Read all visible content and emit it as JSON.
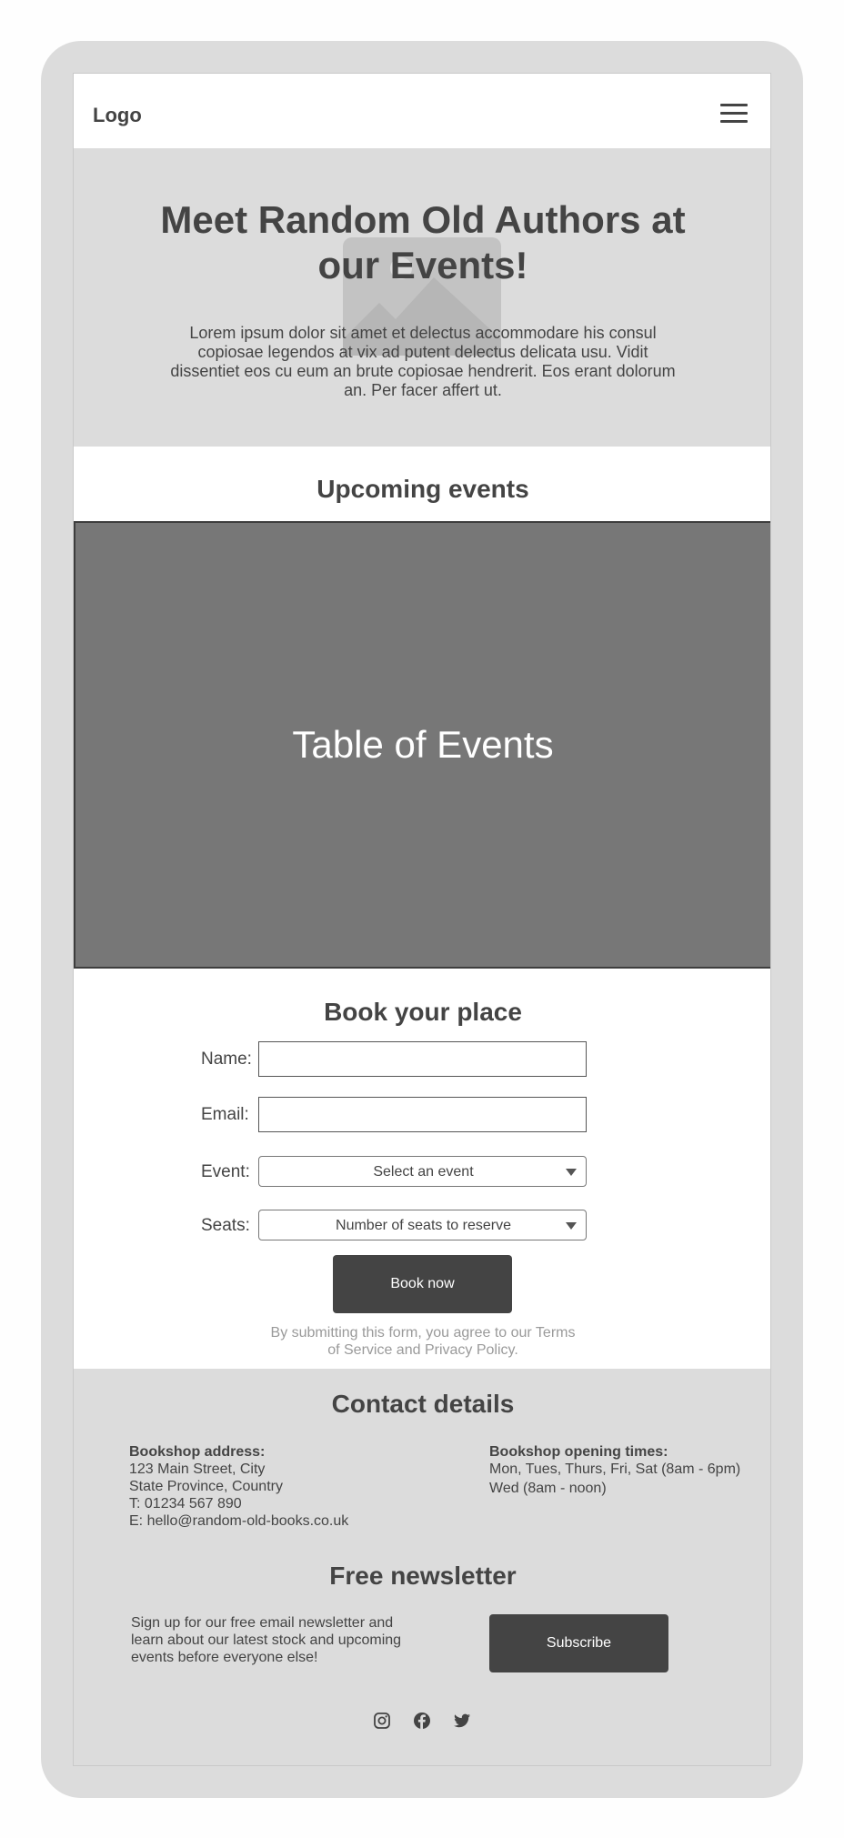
{
  "header": {
    "logo": "Logo",
    "menu_icon": "hamburger-menu-icon"
  },
  "hero": {
    "title": "Meet Random Old Authors at our Events!",
    "text": "Lorem ipsum dolor sit amet et delectus accommodare his consul copiosae legendos at vix ad putent delectus delicata usu. Vidit dissentiet eos cu eum an brute copiosae hendrerit. Eos erant dolorum an. Per facer affert ut.",
    "image_icon": "image-placeholder-icon"
  },
  "events": {
    "title": "Upcoming events",
    "table_label": "Table of Events"
  },
  "booking": {
    "title": "Book your place",
    "name_label": "Name:",
    "name_value": "",
    "email_label": "Email:",
    "email_value": "",
    "event_label": "Event:",
    "event_selected": "Select an event",
    "seats_label": "Seats:",
    "seats_selected": "Number of seats to reserve",
    "submit_label": "Book now",
    "disclaimer": "By submitting this form, you agree to our Terms of Service and Privacy Policy."
  },
  "contact": {
    "title": "Contact details",
    "address_heading": "Bookshop address:",
    "address_line1": "123 Main Street, City",
    "address_line2": "State Province, Country",
    "phone": "T: 01234 567 890",
    "email": "E: hello@random-old-books.co.uk",
    "hours_heading": "Bookshop opening times:",
    "hours_line1": "Mon, Tues, Thurs, Fri, Sat (8am - 6pm)",
    "hours_line2": "Wed (8am - noon)"
  },
  "newsletter": {
    "title": "Free newsletter",
    "text": "Sign up for our free email newsletter and learn about our latest stock and upcoming events before everyone else!",
    "button_label": "Subscribe"
  },
  "social": {
    "icons": [
      "instagram-icon",
      "facebook-icon",
      "twitter-icon"
    ]
  },
  "colors": {
    "device_frame": "#dcdcdc",
    "section_bg": "#dcdcdc",
    "dark": "#444444",
    "table_bg": "#777777",
    "muted_text": "#9a9a9a"
  }
}
